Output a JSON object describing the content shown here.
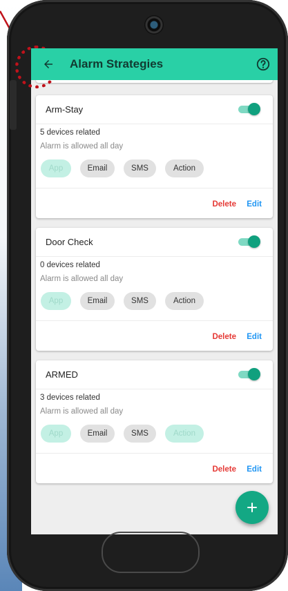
{
  "appbar": {
    "title": "Alarm Strategies",
    "back_icon": "arrow-left-icon",
    "help_icon": "help-circle-icon"
  },
  "cards": [
    {
      "name": "Arm-Stay",
      "devices": "5 devices related",
      "allowed": "Alarm is allowed all day",
      "chips": [
        {
          "label": "App",
          "active": true
        },
        {
          "label": "Email",
          "active": false
        },
        {
          "label": "SMS",
          "active": false
        },
        {
          "label": "Action",
          "active": false
        }
      ],
      "toggle_on": true,
      "delete_label": "Delete",
      "edit_label": "Edit"
    },
    {
      "name": "Door Check",
      "devices": "0 devices related",
      "allowed": "Alarm is allowed all day",
      "chips": [
        {
          "label": "App",
          "active": true
        },
        {
          "label": "Email",
          "active": false
        },
        {
          "label": "SMS",
          "active": false
        },
        {
          "label": "Action",
          "active": false
        }
      ],
      "toggle_on": true,
      "delete_label": "Delete",
      "edit_label": "Edit"
    },
    {
      "name": "ARMED",
      "devices": "3 devices related",
      "allowed": "Alarm is allowed all day",
      "chips": [
        {
          "label": "App",
          "active": true
        },
        {
          "label": "Email",
          "active": false
        },
        {
          "label": "SMS",
          "active": false
        },
        {
          "label": "Action",
          "active": true
        }
      ],
      "toggle_on": true,
      "delete_label": "Delete",
      "edit_label": "Edit"
    }
  ],
  "fab": {
    "icon": "plus-icon"
  },
  "colors": {
    "appbar": "#29d0a6",
    "toggle": "#10a07e",
    "delete": "#e53935",
    "edit": "#2196f3",
    "fab": "#13a884",
    "annotation": "#c0121b"
  }
}
